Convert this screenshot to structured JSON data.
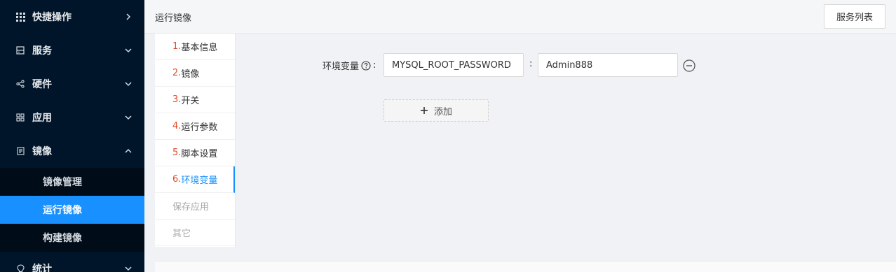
{
  "sidebar": {
    "items": [
      {
        "label": "快捷操作",
        "icon": "grid-icon",
        "arrow": "right"
      },
      {
        "label": "服务",
        "icon": "server-icon",
        "arrow": "down"
      },
      {
        "label": "硬件",
        "icon": "share-icon",
        "arrow": "down"
      },
      {
        "label": "应用",
        "icon": "apps-icon",
        "arrow": "down"
      },
      {
        "label": "镜像",
        "icon": "file-icon",
        "arrow": "up"
      },
      {
        "label": "统计",
        "icon": "bulb-icon",
        "arrow": "down"
      }
    ],
    "image_submenu": [
      {
        "label": "镜像管理",
        "active": false
      },
      {
        "label": "运行镜像",
        "active": true
      },
      {
        "label": "构建镜像",
        "active": false
      }
    ]
  },
  "header": {
    "title": "运行镜像",
    "services_button": "服务列表"
  },
  "steps": [
    {
      "num": "1.",
      "label": "基本信息",
      "state": "normal"
    },
    {
      "num": "2.",
      "label": "镜像",
      "state": "normal"
    },
    {
      "num": "3.",
      "label": "开关",
      "state": "normal"
    },
    {
      "num": "4.",
      "label": "运行参数",
      "state": "normal"
    },
    {
      "num": "5.",
      "label": "脚本设置",
      "state": "normal"
    },
    {
      "num": "6.",
      "label": "环境变量",
      "state": "active"
    },
    {
      "num": "",
      "label": "保存应用",
      "state": "disabled"
    },
    {
      "num": "",
      "label": "其它",
      "state": "disabled"
    }
  ],
  "form": {
    "env_label": "环境变量",
    "label_colon": ":",
    "separator": ":",
    "env_key": "MYSQL_ROOT_PASSWORD",
    "env_value": "Admin888",
    "add_label": "添加"
  },
  "colors": {
    "sidebar_bg": "#001529",
    "active_blue": "#1890ff",
    "step_number_red": "#e04b2a"
  }
}
